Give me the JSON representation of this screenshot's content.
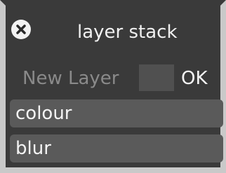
{
  "window": {
    "title": "layer stack",
    "close_icon": "close-icon"
  },
  "new_layer": {
    "label": "New Layer",
    "input_value": "",
    "ok_label": "OK"
  },
  "layers": [
    {
      "label": "colour"
    },
    {
      "label": "blur"
    }
  ],
  "colors": {
    "panel_bg": "#3a3a3a",
    "item_bg": "#5a5a5a",
    "text": "#f0f0f0",
    "muted_text": "#8a8a8a"
  }
}
